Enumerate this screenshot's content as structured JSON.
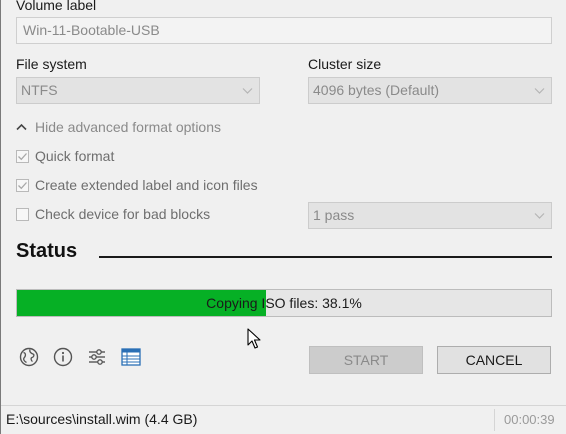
{
  "volume": {
    "label": "Volume label",
    "value": "Win-11-Bootable-USB"
  },
  "file_system": {
    "label": "File system",
    "selected": "NTFS"
  },
  "cluster_size": {
    "label": "Cluster size",
    "selected": "4096 bytes (Default)"
  },
  "advanced_toggle": {
    "label": "Hide advanced format options",
    "icon": "chevron-up-icon"
  },
  "options": {
    "quick_format": {
      "label": "Quick format",
      "checked": true
    },
    "extended_label": {
      "label": "Create extended label and icon files",
      "checked": true
    },
    "bad_blocks": {
      "label": "Check device for bad blocks",
      "checked": false
    },
    "passes": "1 pass"
  },
  "status": {
    "title": "Status",
    "progress_text": "Copying ISO files: 38.1%",
    "progress_fraction": 0.466,
    "progress_color": "#06b025"
  },
  "toolbar_icons": [
    "globe-icon",
    "info-icon",
    "settings-sliders-icon",
    "log-table-icon"
  ],
  "buttons": {
    "start": "START",
    "cancel": "CANCEL"
  },
  "statusbar": {
    "text": "E:\\sources\\install.wim (4.4 GB)",
    "elapsed": "00:00:39"
  }
}
